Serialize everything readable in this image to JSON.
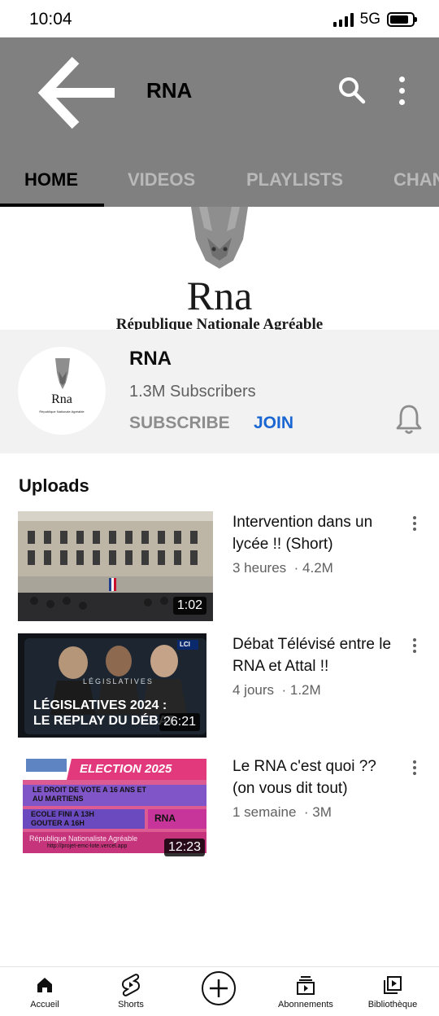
{
  "status_bar": {
    "time": "10:04",
    "network": "5G",
    "signal_icon": "cellular-signal-icon",
    "battery_icon": "battery-icon"
  },
  "header": {
    "title": "RNA",
    "back_icon": "arrow-left-icon",
    "search_icon": "search-icon",
    "more_icon": "more-vertical-icon",
    "background_color": "#808080"
  },
  "tabs": [
    {
      "label": "HOME",
      "active": true
    },
    {
      "label": "VIDEOS",
      "active": false
    },
    {
      "label": "PLAYLISTS",
      "active": false
    },
    {
      "label": "CHANNELS",
      "active": false
    }
  ],
  "banner": {
    "logo_icon": "rhino-head-logo",
    "name": "Rna",
    "subtitle": "République Nationale Agréable"
  },
  "channel": {
    "avatar_name": "Rna",
    "avatar_subtitle": "République Nationale Agréable",
    "name": "RNA",
    "subscribers": "1.3M Subscribers",
    "subscribe_label": "SUBSCRIBE",
    "join_label": "JOIN",
    "bell_icon": "bell-icon"
  },
  "uploads": {
    "title": "Uploads",
    "videos": [
      {
        "title": "Intervention dans un lycée !! (Short)",
        "age": "3 heures",
        "views": "4.2M",
        "duration": "1:02",
        "thumbnail": "building-courtyard-ceremony"
      },
      {
        "title": "Débat Télévisé entre le RNA et Attal !!",
        "age": "4 jours",
        "views": "1.2M",
        "duration": "26:21",
        "thumbnail": "debate-replay",
        "thumb_line1": "LÉGISLATIVES 2024 :",
        "thumb_line2": "LE REPLAY DU DÉBAT",
        "thumb_watermark": "LÉGISLATIVES",
        "thumb_channel": "LCI"
      },
      {
        "title": "Le RNA c'est quoi ?? (on vous dit tout)",
        "age": "1 semaine",
        "views": "3M",
        "duration": "12:23",
        "thumbnail": "election-2025-poster",
        "thumb_election": "ELECTION 2025",
        "thumb_vote": "LE DROIT DE VOTE A 16 ANS ET AU MARTIENS",
        "thumb_ecole": "ECOLE FINI A 13H GOUTER A 16H",
        "thumb_rna": "RNA",
        "thumb_rep": "République Nationaliste Agréable",
        "thumb_url": "http://projet-emc-lote.vercel.app"
      }
    ]
  },
  "bottom_nav": [
    {
      "label": "Accueil",
      "icon": "home-icon"
    },
    {
      "label": "Shorts",
      "icon": "shorts-icon"
    },
    {
      "label": "",
      "icon": "create-plus-icon"
    },
    {
      "label": "Abonnements",
      "icon": "subscriptions-icon"
    },
    {
      "label": "Bibliothèque",
      "icon": "library-icon"
    }
  ]
}
